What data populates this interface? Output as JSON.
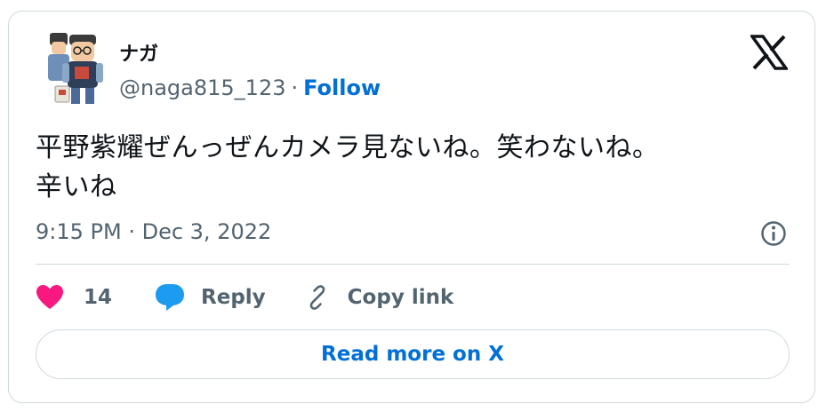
{
  "author": {
    "name": "ナガ",
    "handle": "@naga815_123",
    "separator": "·",
    "follow_label": "Follow"
  },
  "tweet": {
    "text_line1": "平野紫耀ぜんっぜんカメラ見ないね。笑わないね。",
    "text_line2": "辛いね",
    "timestamp": "9:15 PM · Dec 3, 2022"
  },
  "actions": {
    "like_count": "14",
    "reply_label": "Reply",
    "copy_label": "Copy link"
  },
  "footer": {
    "read_more_label": "Read more on X"
  },
  "icons": {
    "brand": "x-logo-icon",
    "info": "info-icon",
    "like": "heart-icon",
    "reply": "speech-bubble-icon",
    "copy": "link-icon"
  },
  "colors": {
    "accent": "#006fd6",
    "like": "#f91880",
    "reply": "#1d9bf0",
    "muted": "#536471",
    "border": "#cfd9de",
    "text": "#0f1419"
  }
}
